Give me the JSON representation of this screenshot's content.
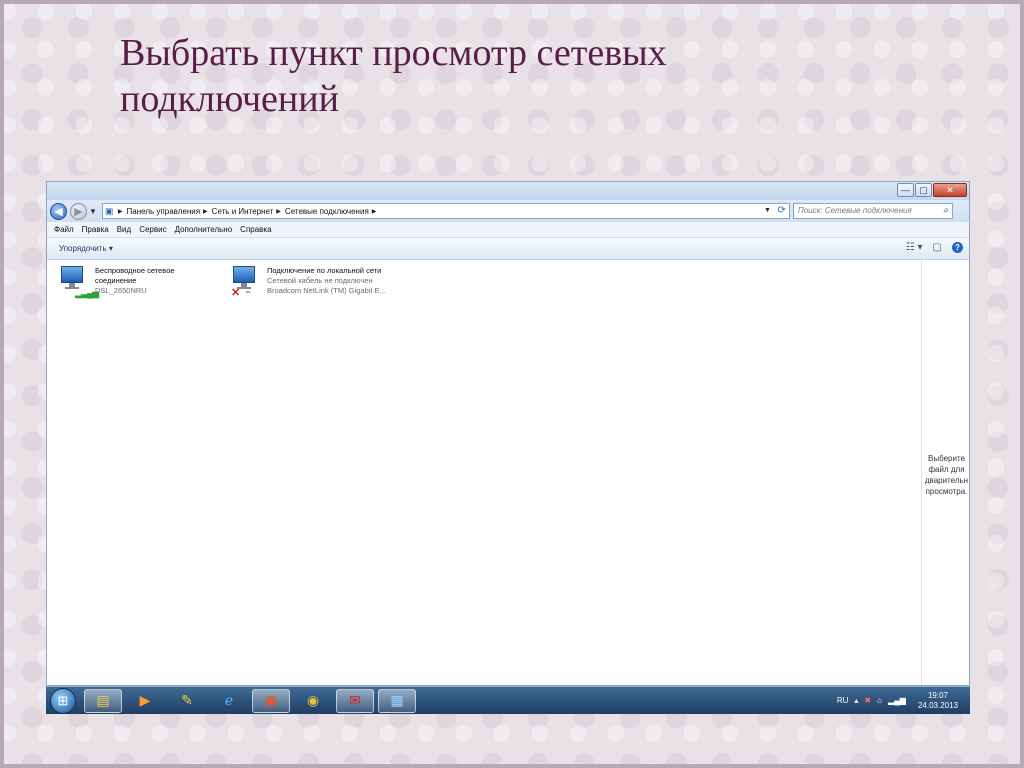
{
  "slide": {
    "title_line1": "Выбрать пункт просмотр сетевых",
    "title_line2": "подключений"
  },
  "window": {
    "controls": {
      "minimize": "—",
      "maximize": "▢",
      "close": "✕"
    }
  },
  "address": {
    "crumbs": [
      "Панель управления",
      "Сеть и Интернет",
      "Сетевые подключения"
    ],
    "search_placeholder": "Поиск: Сетевые подключения"
  },
  "menu": [
    "Файл",
    "Правка",
    "Вид",
    "Сервис",
    "Дополнительно",
    "Справка"
  ],
  "toolbar": {
    "organize": "Упорядочить ▾"
  },
  "connections": [
    {
      "name_line1": "Беспроводное сетевое",
      "name_line2": "соединение",
      "sub": "DSL_2650NRU"
    },
    {
      "name_line1": "Подключение по локальной сети",
      "status": "Сетевой кабель не подключен",
      "adapter": "Broadcom NetLink (TM) Gigabit E..."
    }
  ],
  "preview": {
    "line1": "Выберите",
    "line2": "файл для",
    "line3": "дварительн",
    "line4": "просмотра."
  },
  "taskbar": {
    "apps": [
      "folder-icon",
      "media-player-icon",
      "paint-icon",
      "ie-icon",
      "presentation-icon",
      "chrome-icon",
      "pdf-icon",
      "network-icon"
    ],
    "lang": "RU",
    "time": "19:07",
    "date": "24.03.2013"
  },
  "colors": {
    "title": "#5a1d4a",
    "taskbar": "#2b4f78"
  }
}
